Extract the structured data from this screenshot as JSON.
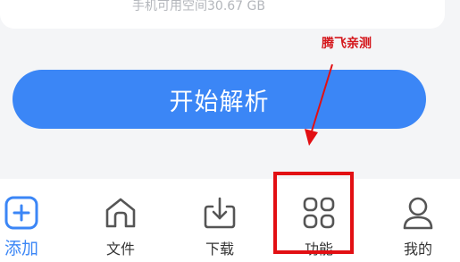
{
  "storage": {
    "available_text": "手机可用空间30.67 GB"
  },
  "watermark": {
    "text": "腾飞亲测"
  },
  "main": {
    "start_button_label": "开始解析"
  },
  "nav": {
    "items": [
      {
        "label": "添加",
        "icon": "add-square-icon",
        "active": true
      },
      {
        "label": "文件",
        "icon": "home-file-icon",
        "active": false
      },
      {
        "label": "下载",
        "icon": "download-icon",
        "active": false
      },
      {
        "label": "功能",
        "icon": "features-grid-icon",
        "active": false
      },
      {
        "label": "我的",
        "icon": "profile-icon",
        "active": false
      }
    ]
  },
  "colors": {
    "accent": "#3b86f6",
    "annotation": "#e20f13",
    "background": "#f4f5f7"
  }
}
